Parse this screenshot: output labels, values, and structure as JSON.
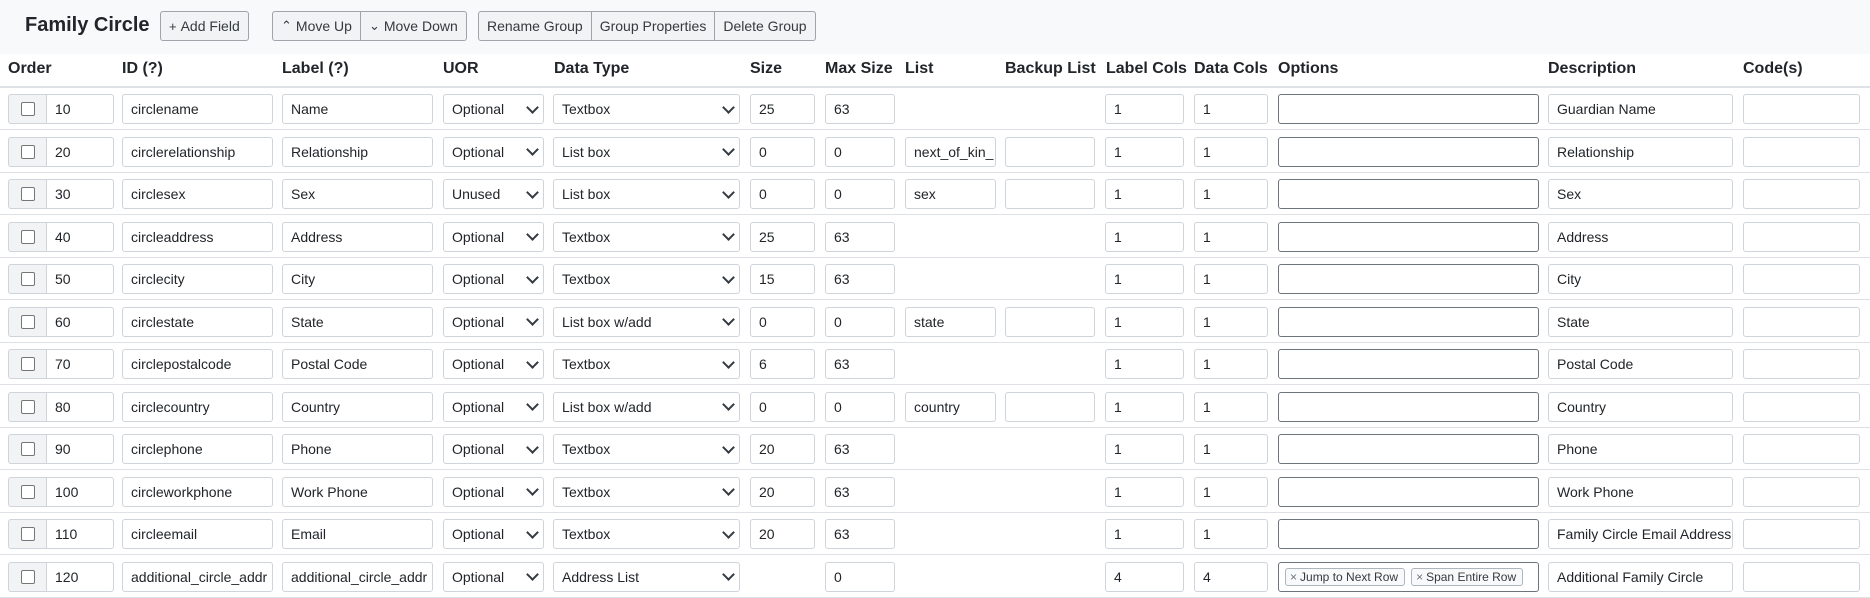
{
  "page": {
    "title": "Family Circle"
  },
  "toolbar": {
    "add_field": "Add Field",
    "move_up": "Move Up",
    "move_down": "Move Down",
    "rename_group": "Rename Group",
    "group_properties": "Group Properties",
    "delete_group": "Delete Group"
  },
  "columns": {
    "order": "Order",
    "id": "ID (?)",
    "label": "Label (?)",
    "uor": "UOR",
    "data_type": "Data Type",
    "size": "Size",
    "max_size": "Max Size",
    "list": "List",
    "backup_list": "Backup List",
    "label_cols": "Label Cols",
    "data_cols": "Data Cols",
    "options": "Options",
    "description": "Description",
    "codes": "Code(s)"
  },
  "rows": [
    {
      "order": "10",
      "id": "circlename",
      "label": "Name",
      "uor": "Optional",
      "data_type": "Textbox",
      "size": "25",
      "max_size": "63",
      "list": null,
      "backup_list": null,
      "label_cols": "1",
      "data_cols": "1",
      "options": [],
      "description": "Guardian Name",
      "codes": ""
    },
    {
      "order": "20",
      "id": "circlerelationship",
      "label": "Relationship",
      "uor": "Optional",
      "data_type": "List box",
      "size": "0",
      "max_size": "0",
      "list": "next_of_kin_",
      "backup_list": "",
      "label_cols": "1",
      "data_cols": "1",
      "options": [],
      "description": "Relationship",
      "codes": ""
    },
    {
      "order": "30",
      "id": "circlesex",
      "label": "Sex",
      "uor": "Unused",
      "data_type": "List box",
      "size": "0",
      "max_size": "0",
      "list": "sex",
      "backup_list": "",
      "label_cols": "1",
      "data_cols": "1",
      "options": [],
      "description": "Sex",
      "codes": ""
    },
    {
      "order": "40",
      "id": "circleaddress",
      "label": "Address",
      "uor": "Optional",
      "data_type": "Textbox",
      "size": "25",
      "max_size": "63",
      "list": null,
      "backup_list": null,
      "label_cols": "1",
      "data_cols": "1",
      "options": [],
      "description": "Address",
      "codes": ""
    },
    {
      "order": "50",
      "id": "circlecity",
      "label": "City",
      "uor": "Optional",
      "data_type": "Textbox",
      "size": "15",
      "max_size": "63",
      "list": null,
      "backup_list": null,
      "label_cols": "1",
      "data_cols": "1",
      "options": [],
      "description": "City",
      "codes": ""
    },
    {
      "order": "60",
      "id": "circlestate",
      "label": "State",
      "uor": "Optional",
      "data_type": "List box w/add",
      "size": "0",
      "max_size": "0",
      "list": "state",
      "backup_list": "",
      "label_cols": "1",
      "data_cols": "1",
      "options": [],
      "description": "State",
      "codes": ""
    },
    {
      "order": "70",
      "id": "circlepostalcode",
      "label": "Postal Code",
      "uor": "Optional",
      "data_type": "Textbox",
      "size": "6",
      "max_size": "63",
      "list": null,
      "backup_list": null,
      "label_cols": "1",
      "data_cols": "1",
      "options": [],
      "description": "Postal Code",
      "codes": ""
    },
    {
      "order": "80",
      "id": "circlecountry",
      "label": "Country",
      "uor": "Optional",
      "data_type": "List box w/add",
      "size": "0",
      "max_size": "0",
      "list": "country",
      "backup_list": "",
      "label_cols": "1",
      "data_cols": "1",
      "options": [],
      "description": "Country",
      "codes": ""
    },
    {
      "order": "90",
      "id": "circlephone",
      "label": "Phone",
      "uor": "Optional",
      "data_type": "Textbox",
      "size": "20",
      "max_size": "63",
      "list": null,
      "backup_list": null,
      "label_cols": "1",
      "data_cols": "1",
      "options": [],
      "description": "Phone",
      "codes": ""
    },
    {
      "order": "100",
      "id": "circleworkphone",
      "label": "Work Phone",
      "uor": "Optional",
      "data_type": "Textbox",
      "size": "20",
      "max_size": "63",
      "list": null,
      "backup_list": null,
      "label_cols": "1",
      "data_cols": "1",
      "options": [],
      "description": "Work Phone",
      "codes": ""
    },
    {
      "order": "110",
      "id": "circleemail",
      "label": "Email",
      "uor": "Optional",
      "data_type": "Textbox",
      "size": "20",
      "max_size": "63",
      "list": null,
      "backup_list": null,
      "label_cols": "1",
      "data_cols": "1",
      "options": [],
      "description": "Family Circle Email Address",
      "codes": ""
    },
    {
      "order": "120",
      "id": "additional_circle_addr",
      "label": "additional_circle_addr",
      "uor": "Optional",
      "data_type": "Address List",
      "size": null,
      "max_size": "0",
      "list": null,
      "backup_list": null,
      "label_cols": "4",
      "data_cols": "4",
      "options": [
        "Jump to Next Row",
        "Span Entire Row"
      ],
      "description": "Additional Family Circle",
      "codes": ""
    }
  ]
}
